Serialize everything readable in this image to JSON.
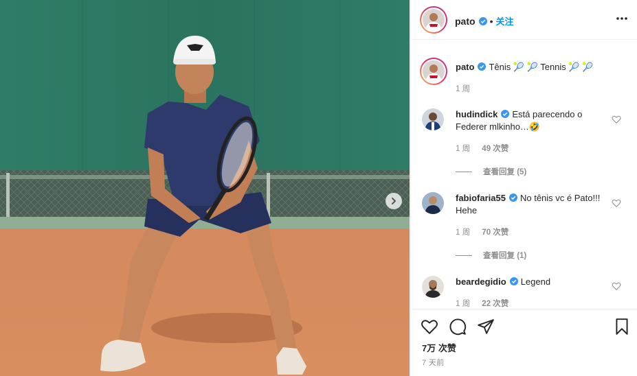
{
  "post": {
    "username": "pato",
    "follow_label": "关注",
    "separator": "•",
    "caption": {
      "username": "pato",
      "text": "Tênis 🎾 🎾 Tennis 🎾 🎾",
      "time": "1 周"
    }
  },
  "comments": [
    {
      "username": "hudindick",
      "text": "Está parecendo o Federer mlkinho…🤣",
      "time": "1 周",
      "likes": "49 次赞",
      "replies": "查看回复 (5)"
    },
    {
      "username": "fabiofaria55",
      "text": "No tênis vc é Pato!!! Hehe",
      "time": "1 周",
      "likes": "70 次赞",
      "replies": "查看回复 (1)"
    },
    {
      "username": "beardegidio",
      "text": "Legend",
      "time": "1 周",
      "likes": "22 次赞"
    }
  ],
  "footer": {
    "likes_total": "7万 次赞",
    "posted": "7 天前"
  },
  "colors": {
    "verified_blue": "#3897f0",
    "follow_blue": "#0095f6",
    "wall_green": "#2d7a67",
    "clay_court": "#d7895a",
    "muted_text": "#8e8e8e"
  },
  "icons": [
    "verified-badge-icon",
    "more-options-icon",
    "heart-icon",
    "comment-icon",
    "share-icon",
    "bookmark-icon",
    "chevron-right-icon"
  ]
}
